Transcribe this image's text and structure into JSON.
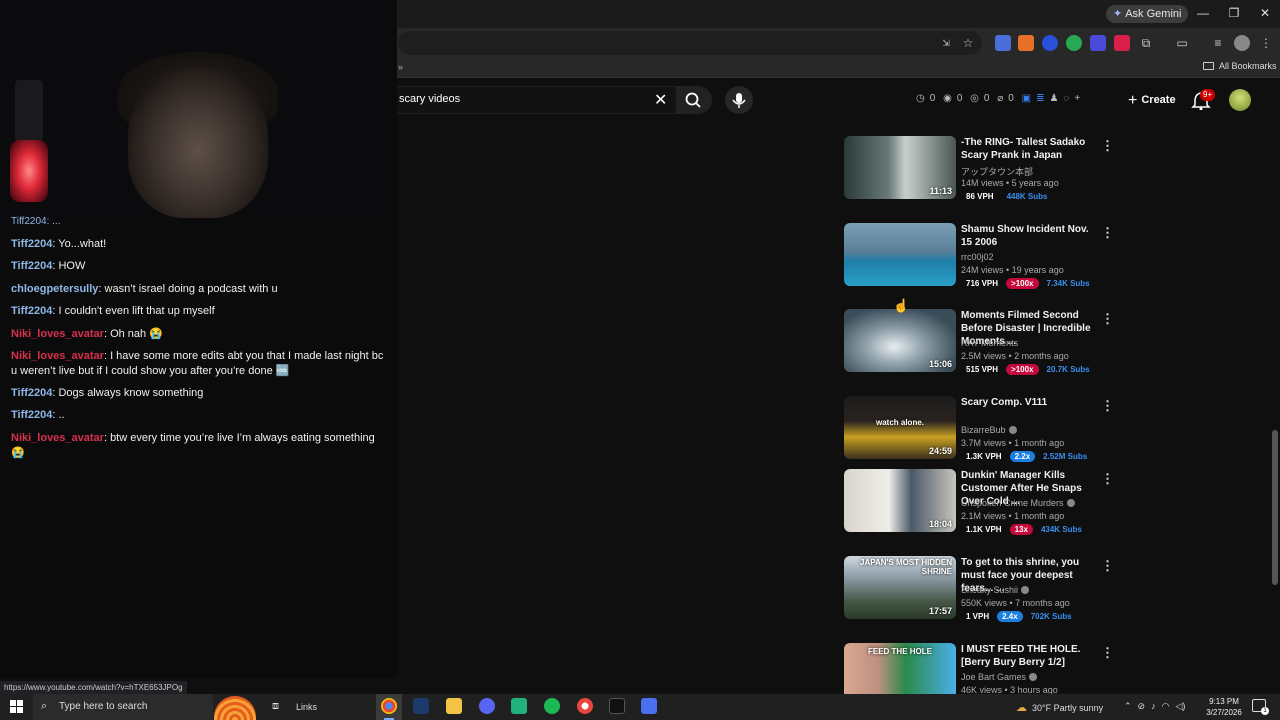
{
  "browser": {
    "ask_gemini": "Ask Gemini",
    "all_bookmarks": "All Bookmarks",
    "status_url": "https://www.youtube.com/watch?v=hTXE653JPOg"
  },
  "youtube": {
    "search_value": "scary videos",
    "stats": [
      "0",
      "0",
      "0",
      "0"
    ],
    "create_label": "Create",
    "notification_badge": "9+"
  },
  "chat": {
    "cut_line": "Tiff2204: ...",
    "messages": [
      {
        "user": "Tiff2204",
        "text": ": Yo...what!",
        "color": "#8fb8e8"
      },
      {
        "user": "Tiff2204",
        "text": ": HOW",
        "color": "#8fb8e8"
      },
      {
        "user": "chloegpetersully",
        "text": ": wasn’t israel doing a podcast with u",
        "color": "#8fb8e8"
      },
      {
        "user": "Tiff2204",
        "text": ": I couldn't even lift that up myself",
        "color": "#8fb8e8"
      },
      {
        "user": "Niki_loves_avatar",
        "text": ": Oh nah 😭",
        "color": "#d9304f"
      },
      {
        "user": "Niki_loves_avatar",
        "text": ": I have some more edits abt you that I made last night bc u weren’t live but if I could show you after you’re done 🆒",
        "color": "#d9304f"
      },
      {
        "user": "Tiff2204",
        "text": ": Dogs always know something",
        "color": "#8fb8e8"
      },
      {
        "user": "Tiff2204",
        "text": ": ..",
        "color": "#8fb8e8"
      },
      {
        "user": "Niki_loves_avatar",
        "text": ": btw every time you’re live I’m always eating something 😭",
        "color": "#d9304f"
      }
    ]
  },
  "videos": [
    {
      "title": "-The RING- Tallest Sadako Scary Prank in Japan",
      "channel": "アップタウン本部",
      "verified": false,
      "meta": "14M views • 5 years ago",
      "duration": "11:13",
      "vph": "86 VPH",
      "ratio": "",
      "subs": "448K Subs",
      "thumb": "ring"
    },
    {
      "title": "Shamu Show Incident Nov. 15 2006",
      "channel": "rrc00j02",
      "verified": false,
      "meta": "24M views • 19 years ago",
      "duration": "",
      "vph": "716 VPH",
      "ratio": ">100x",
      "ratio_color": "red",
      "subs": "7.34K Subs",
      "thumb": "shamu"
    },
    {
      "title": "Moments Filmed Second Before Disaster | Incredible Moments ...",
      "channel": "RAY Moments",
      "verified": false,
      "meta": "2.5M views • 2 months ago",
      "duration": "15:06",
      "vph": "515 VPH",
      "ratio": ">100x",
      "ratio_color": "red",
      "subs": "20.7K Subs",
      "thumb": "wave"
    },
    {
      "title": "Scary Comp. V111",
      "channel": "BizarreBub",
      "verified": true,
      "meta": "3.7M views • 1 month ago",
      "duration": "24:59",
      "vph": "1.3K VPH",
      "ratio": "2.2x",
      "ratio_color": "blue",
      "subs": "2.52M Subs",
      "thumb": "hall",
      "thumb_text": "watch alone."
    },
    {
      "title": "Dunkin' Manager Kills Customer After He Snaps Over Cold ...",
      "channel": "Unspoken Crime Murders",
      "verified": true,
      "meta": "2.1M views • 1 month ago",
      "duration": "18:04",
      "vph": "1.1K VPH",
      "ratio": "13x",
      "ratio_color": "red",
      "subs": "434K Subs",
      "thumb": "dunkin"
    },
    {
      "title": "To get to this shrine, you must face your deepest fears... ...",
      "channel": "Sneaky Sushii",
      "verified": true,
      "meta": "550K views • 7 months ago",
      "duration": "17:57",
      "vph": "1 VPH",
      "ratio": "2.4x",
      "ratio_color": "blue",
      "subs": "702K Subs",
      "thumb": "shrine",
      "thumb_text": "JAPAN'S MOST HIDDEN SHRINE"
    },
    {
      "title": "I MUST FEED THE HOLE. [Berry Bury Berry 1/2]",
      "channel": "Joe Bart Games",
      "verified": true,
      "meta": "46K views • 3 hours ago",
      "duration": "",
      "vph": "",
      "ratio": "",
      "subs": "",
      "thumb": "hole",
      "thumb_text": "FEED THE HOLE"
    }
  ],
  "taskbar": {
    "search_placeholder": "Type here to search",
    "links_label": "Links",
    "weather": "30°F  Partly sunny",
    "time": "9:13 PM",
    "date": "3/27/2026",
    "notifications": "1"
  },
  "colors": {
    "youtube_bg": "#0f0f0f",
    "chrome_toolbar": "#282828",
    "taskbar": "#202020",
    "accent_red": "#cc0000"
  }
}
